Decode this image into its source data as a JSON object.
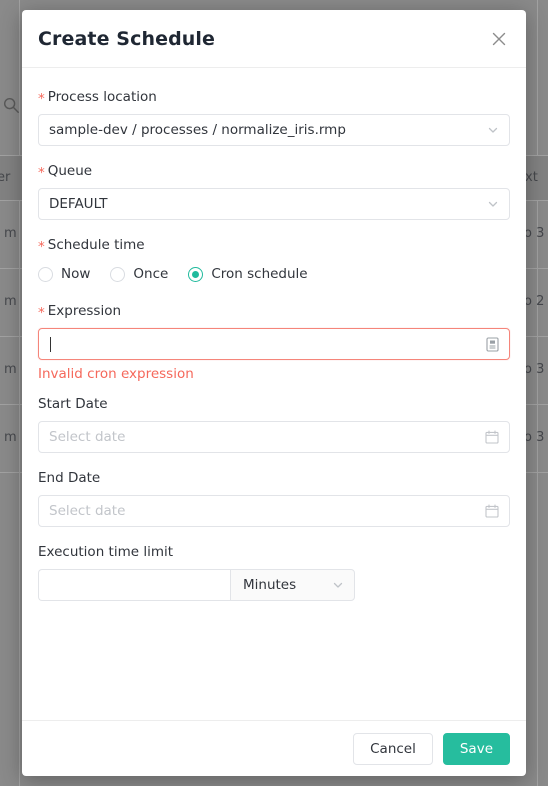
{
  "background": {
    "search_icon": "search-icon",
    "columns": [
      {
        "label_fragment": "er"
      },
      {
        "label_fragment": "xt"
      }
    ],
    "rows": [
      {
        "left_fragment": "m",
        "right_fragment": "o 3"
      },
      {
        "left_fragment": "m",
        "right_fragment": "o 2"
      },
      {
        "left_fragment": "m",
        "right_fragment": "o 3"
      },
      {
        "left_fragment": "m",
        "right_fragment": "o 3"
      }
    ]
  },
  "modal": {
    "title": "Create Schedule",
    "close_icon": "close-icon",
    "fields": {
      "process_location": {
        "label": "Process location",
        "required_marker": "*",
        "value": "sample-dev / processes / normalize_iris.rmp",
        "caret_icon": "chevron-down-icon"
      },
      "queue": {
        "label": "Queue",
        "required_marker": "*",
        "value": "DEFAULT",
        "caret_icon": "chevron-down-icon"
      },
      "schedule_time": {
        "label": "Schedule time",
        "required_marker": "*",
        "options": [
          {
            "label": "Now",
            "selected": false
          },
          {
            "label": "Once",
            "selected": false
          },
          {
            "label": "Cron schedule",
            "selected": true
          }
        ],
        "selected_value": "Cron schedule"
      },
      "expression": {
        "label": "Expression",
        "required_marker": "*",
        "value": "",
        "placeholder": "",
        "trailing_icon": "cron-builder-icon",
        "error": "Invalid cron expression"
      },
      "start_date": {
        "label": "Start Date",
        "value": "",
        "placeholder": "Select date",
        "icon": "calendar-icon"
      },
      "end_date": {
        "label": "End Date",
        "value": "",
        "placeholder": "Select date",
        "icon": "calendar-icon"
      },
      "execution_time_limit": {
        "label": "Execution time limit",
        "value": "",
        "placeholder": "",
        "unit": "Minutes",
        "unit_caret_icon": "chevron-down-icon"
      }
    },
    "footer": {
      "cancel_label": "Cancel",
      "save_label": "Save"
    }
  },
  "colors": {
    "primary": "#26bd9e",
    "required": "#f5685b",
    "error": "#f5685b",
    "error_border": "#f5857a",
    "title": "#1f2733",
    "border": "#e2e4e8",
    "backdrop": "#8a8a8a"
  }
}
